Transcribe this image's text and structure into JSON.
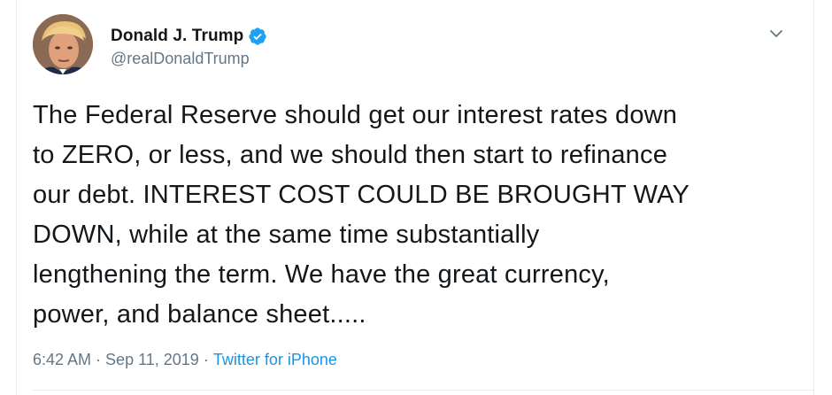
{
  "tweet": {
    "author": {
      "display_name": "Donald J. Trump",
      "handle": "@realDonaldTrump",
      "verified": true
    },
    "text": "The Federal Reserve should get our interest rates down\nto ZERO, or less, and we should then start to refinance\nour debt. INTEREST COST COULD BE BROUGHT WAY\nDOWN, while at the same time substantially\nlengthening the term. We have the great currency,\npower, and balance sheet.....",
    "time": "6:42 AM",
    "separator_1": "·",
    "date": "Sep 11, 2019",
    "separator_2": "·",
    "source": "Twitter for iPhone"
  },
  "icons": {
    "verified": "verified-badge-icon",
    "menu": "chevron-down-icon"
  },
  "colors": {
    "text": "#14171a",
    "muted": "#657786",
    "link": "#1b95e0",
    "verified": "#1da1f2"
  }
}
